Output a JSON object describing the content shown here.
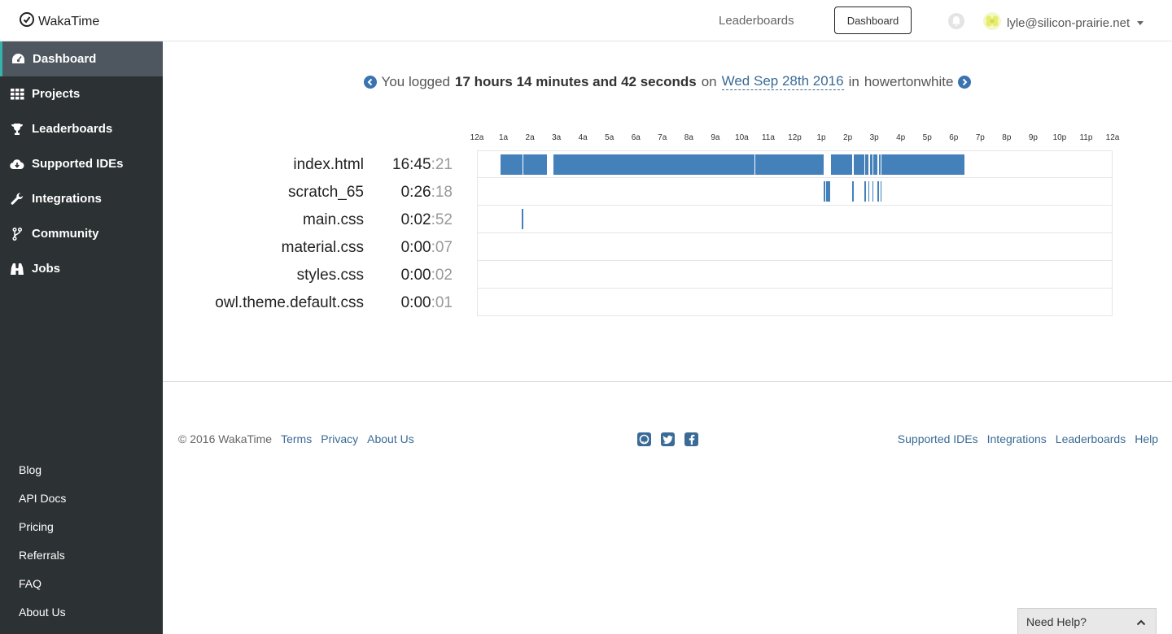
{
  "app": {
    "brand": "WakaTime"
  },
  "topnav": {
    "leaderboards": "Leaderboards",
    "dashboard": "Dashboard",
    "user_email": "lyle@silicon-prairie.net"
  },
  "sidebar": {
    "items": [
      {
        "label": "Dashboard",
        "icon": "dashboard-icon",
        "active": true
      },
      {
        "label": "Projects",
        "icon": "grid-icon",
        "active": false
      },
      {
        "label": "Leaderboards",
        "icon": "trophy-icon",
        "active": false
      },
      {
        "label": "Supported IDEs",
        "icon": "cloud-download-icon",
        "active": false
      },
      {
        "label": "Integrations",
        "icon": "wrench-icon",
        "active": false
      },
      {
        "label": "Community",
        "icon": "code-fork-icon",
        "active": false
      },
      {
        "label": "Jobs",
        "icon": "binoculars-icon",
        "active": false
      }
    ],
    "bottom_links": [
      "Blog",
      "API Docs",
      "Pricing",
      "Referrals",
      "FAQ",
      "About Us"
    ]
  },
  "summary": {
    "prefix": "You logged",
    "duration": "17 hours 14 minutes and 42 seconds",
    "on": "on",
    "date": "Wed Sep 28th 2016",
    "in": "in",
    "project": "howertonwhite"
  },
  "timeline": {
    "hours": [
      "12a",
      "1a",
      "2a",
      "3a",
      "4a",
      "5a",
      "6a",
      "7a",
      "8a",
      "9a",
      "10a",
      "11a",
      "12p",
      "1p",
      "2p",
      "3p",
      "4p",
      "5p",
      "6p",
      "7p",
      "8p",
      "9p",
      "10p",
      "11p",
      "12a"
    ],
    "files": [
      {
        "name": "index.html",
        "time_main": "16:45",
        "time_sec": ":21",
        "segments": [
          [
            0.86,
            1.69
          ],
          [
            1.72,
            2.62
          ],
          [
            2.87,
            10.45
          ],
          [
            10.47,
            13.07
          ],
          [
            13.35,
            14.15
          ],
          [
            14.2,
            14.6
          ],
          [
            14.62,
            14.75
          ],
          [
            14.8,
            14.9
          ],
          [
            14.95,
            15.1
          ],
          [
            15.15,
            15.2
          ],
          [
            15.25,
            18.38
          ]
        ]
      },
      {
        "name": "scratch_65",
        "time_main": "0:26",
        "time_sec": ":18",
        "segments": [
          [
            13.07,
            13.13
          ],
          [
            13.15,
            13.2
          ],
          [
            13.22,
            13.3
          ],
          [
            14.15,
            14.18
          ],
          [
            14.6,
            14.63
          ],
          [
            14.75,
            14.78
          ],
          [
            14.9,
            14.93
          ],
          [
            15.1,
            15.13
          ],
          [
            15.2,
            15.23
          ]
        ]
      },
      {
        "name": "main.css",
        "time_main": "0:02",
        "time_sec": ":52",
        "segments": [
          [
            1.67,
            1.72
          ]
        ]
      },
      {
        "name": "material.css",
        "time_main": "0:00",
        "time_sec": ":07",
        "segments": []
      },
      {
        "name": "styles.css",
        "time_main": "0:00",
        "time_sec": ":02",
        "segments": []
      },
      {
        "name": "owl.theme.default.css",
        "time_main": "0:00",
        "time_sec": ":01",
        "segments": []
      }
    ]
  },
  "footer": {
    "copyright": "© 2016 WakaTime",
    "left_links": [
      "Terms",
      "Privacy",
      "About Us"
    ],
    "social": [
      "github-icon",
      "twitter-icon",
      "facebook-icon"
    ],
    "right_links": [
      "Supported IDEs",
      "Integrations",
      "Leaderboards",
      "Help"
    ]
  },
  "help_widget": {
    "label": "Need Help?"
  },
  "colors": {
    "accent": "#37b3ad",
    "bar": "#4480b9",
    "sidebar": "#2c3133",
    "link": "#3a6a96"
  }
}
